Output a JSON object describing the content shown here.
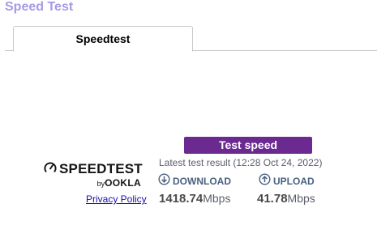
{
  "page": {
    "title": "Speed Test"
  },
  "tabs": [
    {
      "label": "Speedtest"
    }
  ],
  "action": {
    "test_button_label": "Test speed"
  },
  "logo": {
    "wordmark": "SPEEDTEST",
    "by_prefix": "by",
    "by_brand": "OOKLA"
  },
  "links": {
    "privacy_policy": "Privacy Policy"
  },
  "result": {
    "latest_label": "Latest test result (12:28 Oct 24, 2022)",
    "download": {
      "label": "DOWNLOAD",
      "value": "1418.74",
      "unit": "Mbps",
      "icon": "download-arrow-icon"
    },
    "upload": {
      "label": "UPLOAD",
      "value": "41.78",
      "unit": "Mbps",
      "icon": "upload-arrow-icon"
    }
  },
  "colors": {
    "title": "#a59ae6",
    "button": "#6b2a8f",
    "metric_label": "#4a6080",
    "link": "#1a0dab"
  }
}
